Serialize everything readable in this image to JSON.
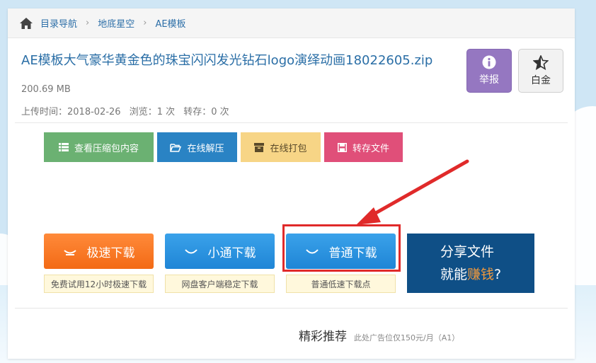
{
  "breadcrumb": {
    "home_icon": "home-icon",
    "items": [
      "目录导航",
      "地底星空",
      "AE模板"
    ]
  },
  "file": {
    "title": "AE模板大气豪华黄金色的珠宝闪闪发光钻石logo演绎动画18022605.zip",
    "size": "200.69 MB",
    "upload_label": "上传时间：2018-02-26",
    "views_label": "浏览：1 次",
    "saves_label": "转存：0 次"
  },
  "side_buttons": {
    "report": {
      "label": "举报",
      "icon": "info-icon",
      "color": "#9577c1"
    },
    "gold": {
      "label": "白金",
      "icon": "star-icon"
    }
  },
  "actions": {
    "view": {
      "label": "查看压缩包内容",
      "icon": "list-icon",
      "color": "#6bb172"
    },
    "unzip": {
      "label": "在线解压",
      "icon": "folder-open-icon",
      "color": "#2a83c4"
    },
    "pack": {
      "label": "在线打包",
      "icon": "archive-icon",
      "color": "#f7d586"
    },
    "save": {
      "label": "转存文件",
      "icon": "save-icon",
      "color": "#e04f79"
    }
  },
  "downloads": {
    "fast": {
      "label": "极速下载",
      "note": "免费试用12小时极速下载",
      "color": "#f36a15"
    },
    "small": {
      "label": "小通下载",
      "note": "网盘客户端稳定下载",
      "color": "#1f85d6"
    },
    "normal": {
      "label": "普通下载",
      "note": "普通低速下载点",
      "color": "#1f85d6"
    }
  },
  "share_ad": {
    "line1": "分享文件",
    "line2_prefix": "就能",
    "line2_highlight": "赚钱",
    "line2_suffix": "?"
  },
  "recommend": {
    "title": "精彩推荐",
    "note": "此处广告位仅150元/月（A1）"
  }
}
